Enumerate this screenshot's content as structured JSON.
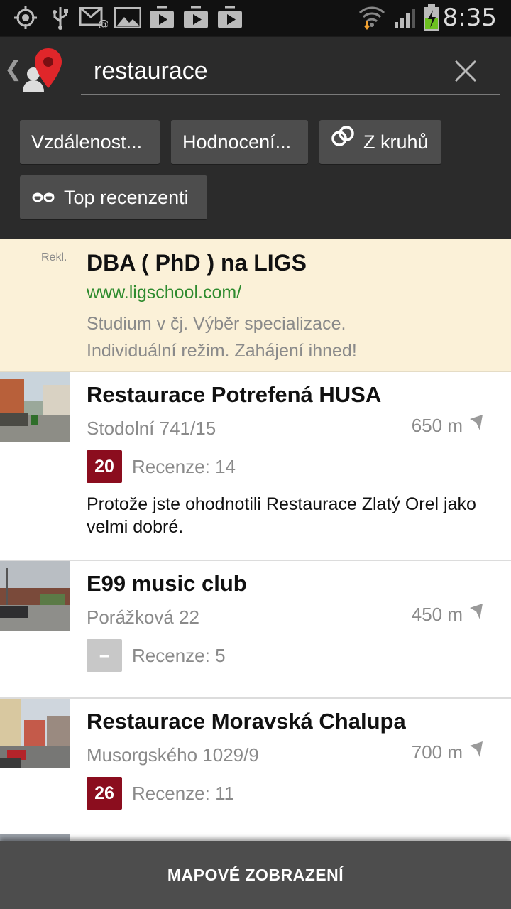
{
  "status_bar": {
    "time": "8:35",
    "icons": [
      "gps-icon",
      "usb-icon",
      "email-icon",
      "gallery-icon",
      "play-store-icon",
      "play-store-icon",
      "play-store-icon",
      "wifi-icon",
      "signal-icon",
      "battery-charging-icon"
    ]
  },
  "search": {
    "value": "restaurace",
    "clear_icon": "close-icon"
  },
  "filters": [
    {
      "label": "Vzdálenost...",
      "icon": ""
    },
    {
      "label": "Hodnocení...",
      "icon": ""
    },
    {
      "label": "Z kruhů",
      "icon": "circles-icon"
    },
    {
      "label": "Top recenzenti",
      "icon": "glasses-icon"
    }
  ],
  "ad": {
    "tag": "Rekl.",
    "title": "DBA ( PhD ) na LIGS",
    "url": "www.ligschool.com/",
    "line1": "Studium v čj. Výběr specializace.",
    "line2": "Individuální režim. Zahájení ihned!"
  },
  "results": [
    {
      "name": "Restaurace Potrefená HUSA",
      "address": "Stodolní 741/15",
      "distance": "650 m",
      "score": "20",
      "reviews": "Recenze: 14",
      "reason": "Protože jste ohodnotili Restaurace Zlatý Orel jako velmi dobré."
    },
    {
      "name": "E99 music club",
      "address": "Porážková 22",
      "distance": "450 m",
      "score": "–",
      "reviews": "Recenze: 5",
      "reason": ""
    },
    {
      "name": "Restaurace Moravská Chalupa",
      "address": "Musorgského 1029/9",
      "distance": "700 m",
      "score": "26",
      "reviews": "Recenze: 11",
      "reason": ""
    }
  ],
  "bottom": {
    "label": "MAPOVÉ ZOBRAZENÍ"
  },
  "colors": {
    "score_bg": "#8b0d1e",
    "ad_bg": "#fbf1d8",
    "ad_url": "#2e8b2e",
    "header_bg": "#2b2b2b"
  }
}
